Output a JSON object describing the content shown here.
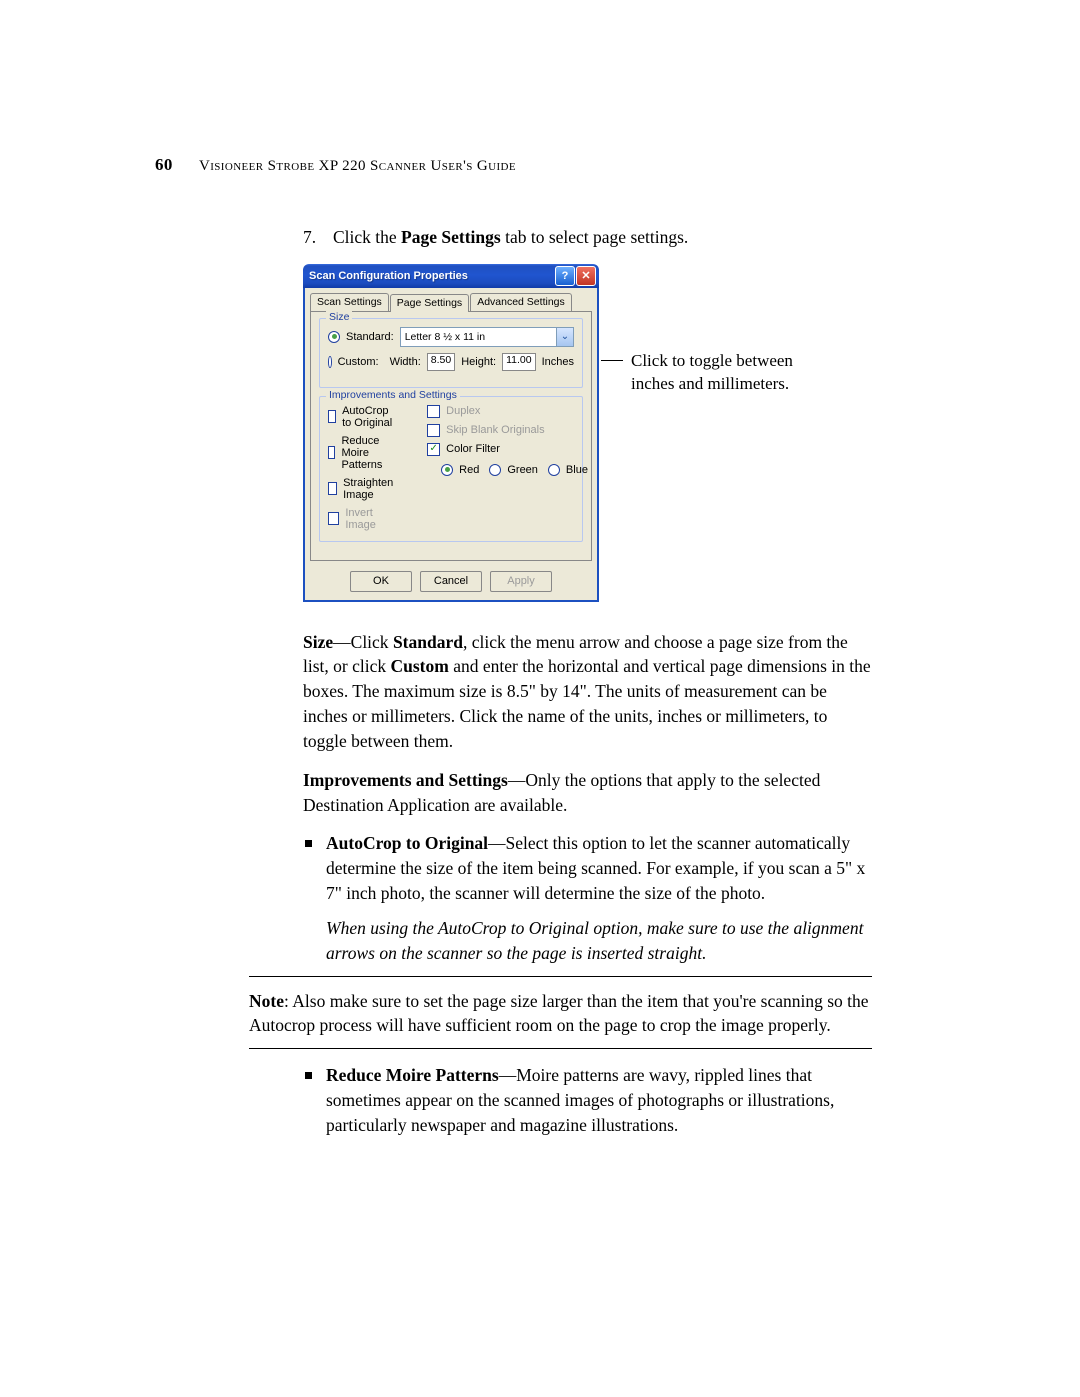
{
  "header": {
    "page_number": "60",
    "title": "Visioneer Strobe XP 220 Scanner User's Guide"
  },
  "step": {
    "number": "7.",
    "before": "Click the ",
    "bold": "Page Settings",
    "after": " tab to select page settings."
  },
  "dialog": {
    "title": "Scan Configuration Properties",
    "tabs": {
      "t1": "Scan Settings",
      "t2": "Page Settings",
      "t3": "Advanced Settings"
    },
    "size": {
      "legend": "Size",
      "standard_label": "Standard:",
      "standard_value": "Letter 8 ½ x 11 in",
      "custom_label": "Custom:",
      "width_label": "Width:",
      "width_value": "8.50",
      "height_label": "Height:",
      "height_value": "11.00",
      "units": "Inches"
    },
    "improvements": {
      "legend": "Improvements and Settings",
      "autocrop": "AutoCrop to Original",
      "moire": "Reduce Moire Patterns",
      "straighten": "Straighten Image",
      "invert": "Invert Image",
      "duplex": "Duplex",
      "skip_blank": "Skip Blank Originals",
      "color_filter": "Color Filter",
      "red": "Red",
      "green": "Green",
      "blue": "Blue"
    },
    "buttons": {
      "ok": "OK",
      "cancel": "Cancel",
      "apply": "Apply"
    }
  },
  "annotation": "Click to toggle between inches and millimeters.",
  "body": {
    "size_para_pre": "Size",
    "size_para_mid1": "—Click ",
    "size_para_b1": "Standard",
    "size_para_mid2": ", click the menu arrow and choose a page size from the list, or click ",
    "size_para_b2": "Custom",
    "size_para_after": " and enter the horizontal and vertical page dimensions in the boxes. The maximum size is 8.5\" by 14\". The units of measurement can be inches or millimeters. Click the name of the units, inches or millimeters, to toggle between them.",
    "imp_b": "Improvements and Settings",
    "imp_after": "—Only the options that apply to the selected Destination Application are available.",
    "bullet1_b": "AutoCrop to Original",
    "bullet1_t": "—Select this option to let the scanner automatically determine the size of the item being scanned. For example, if you scan a 5\" x 7\" inch photo, the scanner will determine the size of the photo.",
    "bullet1_italic": "When using the AutoCrop to Original option, make sure to use the alignment arrows on the scanner so the page is inserted straight.",
    "note_b": "Note",
    "note_t": ":  Also make sure to set the page size larger than the item that you're scanning so the Autocrop process will have sufficient room on the page to crop the image properly.",
    "bullet2_b": "Reduce Moire Patterns",
    "bullet2_t": "—Moire patterns are wavy, rippled lines that sometimes appear on the scanned images of photographs or illustrations, particularly newspaper and magazine illustrations."
  }
}
